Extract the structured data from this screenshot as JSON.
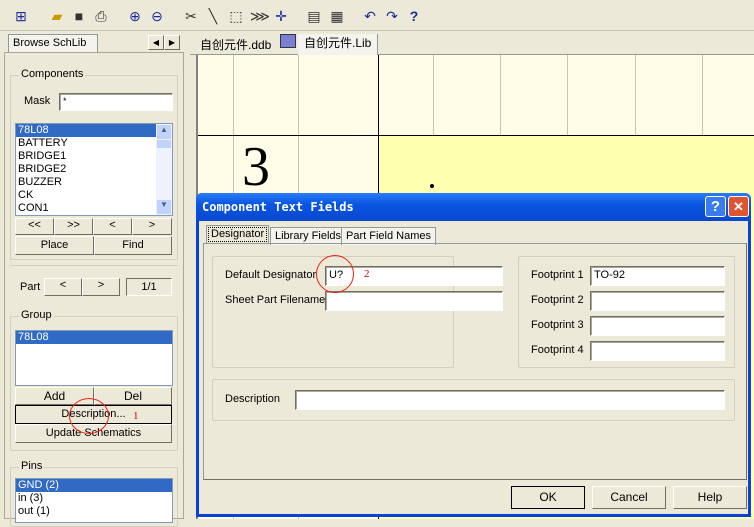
{
  "toolbar": {
    "icons": [
      "hierarchy-icon",
      "open-folder-icon",
      "save-icon",
      "print-icon",
      "zoom-in-icon",
      "zoom-out-icon",
      "cut-wire-icon",
      "draw-line-icon",
      "select-rect-icon",
      "deselect-icon",
      "move-icon",
      "toolbox-icon",
      "component-icon",
      "undo-icon",
      "redo-icon",
      "help-icon"
    ],
    "help_label": "?"
  },
  "left_panel": {
    "tab": "Browse SchLib",
    "components": {
      "title": "Components",
      "mask_label": "Mask",
      "mask_value": "*",
      "items": [
        "78L08",
        "BATTERY",
        "BRIDGE1",
        "BRIDGE2",
        "BUZZER",
        "CK",
        "CON1"
      ],
      "selected": 0,
      "nav": [
        "<<",
        ">>",
        "<",
        ">"
      ],
      "place": "Place",
      "find": "Find"
    },
    "part": {
      "label": "Part",
      "prev": "<",
      "next": ">",
      "value": "1/1"
    },
    "group": {
      "title": "Group",
      "items": [
        "78L08"
      ],
      "add": "Add",
      "del": "Del",
      "description": "Description...",
      "update": "Update Schematics"
    },
    "pins": {
      "title": "Pins",
      "items": [
        "GND  (2)",
        "in  (3)",
        "out  (1)"
      ]
    }
  },
  "doc_tabs": [
    {
      "label": "自创元件.ddb"
    },
    {
      "label": "自创元件.Lib"
    }
  ],
  "canvas": {
    "grid_label": "3"
  },
  "dialog": {
    "title": "Component Text Fields",
    "tabs": [
      "Designator",
      "Library Fields",
      "Part Field Names"
    ],
    "active_tab": 0,
    "default_designator_label": "Default Designator",
    "default_designator": "U?",
    "sheet_part_filename_label": "Sheet Part Filename",
    "sheet_part_filename": "",
    "footprints": [
      {
        "label": "Footprint 1",
        "value": "TO-92"
      },
      {
        "label": "Footprint 2",
        "value": ""
      },
      {
        "label": "Footprint 3",
        "value": ""
      },
      {
        "label": "Footprint 4",
        "value": ""
      }
    ],
    "description_label": "Description",
    "description": "",
    "ok": "OK",
    "cancel": "Cancel",
    "help": "Help",
    "help_icon": "?",
    "close_icon": "✕"
  },
  "annotations": [
    "1",
    "2"
  ]
}
